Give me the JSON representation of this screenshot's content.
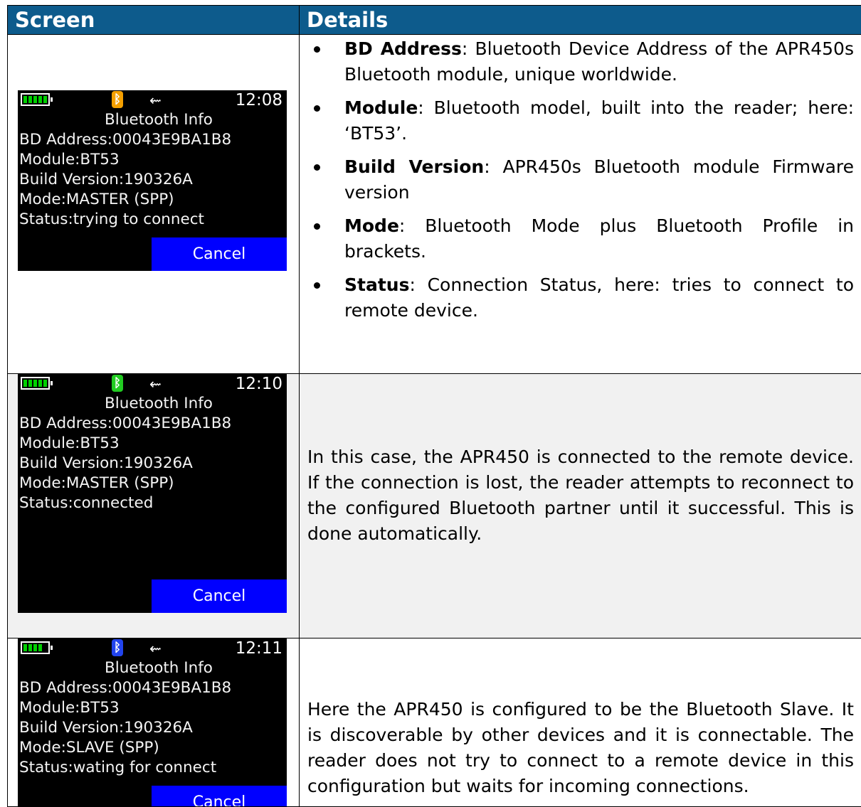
{
  "table": {
    "header_screen": "Screen",
    "header_details": "Details"
  },
  "colors": {
    "header_bg": "#0d5b8c",
    "cancel_bg": "#0000ff",
    "battery": "#00d000"
  },
  "rows": [
    {
      "screen": {
        "time": "12:08",
        "bt_icon_color": "#f5a000",
        "battery_segments": 5,
        "title": "Bluetooth Info",
        "lines": [
          "BD Address:00043E9BA1B8",
          "Module:BT53",
          "Build Version:190326A",
          "Mode:MASTER (SPP)",
          "Status:trying to connect"
        ],
        "cancel": "Cancel",
        "bt_icon": "bluetooth-icon",
        "usb_icon": "usb-icon"
      },
      "items": [
        {
          "term": "BD Address",
          "text": ": Bluetooth Device Address of the APR450s Bluetooth module, unique worldwide."
        },
        {
          "term": "Module",
          "text": ": Bluetooth model, built into the reader; here: ‘BT53’."
        },
        {
          "term": "Build Version",
          "text": ": APR450s Bluetooth module Firmware version"
        },
        {
          "term": "Mode",
          "text": ": Bluetooth Mode plus Bluetooth Profile in brackets."
        },
        {
          "term": "Status",
          "text": ": Connection Status, here: tries to connect to remote device."
        }
      ]
    },
    {
      "screen": {
        "time": "12:10",
        "bt_icon_color": "#22cc22",
        "battery_segments": 5,
        "title": "Bluetooth Info",
        "lines": [
          "BD Address:00043E9BA1B8",
          "Module:BT53",
          "Build Version:190326A",
          "Mode:MASTER (SPP)",
          "Status:connected"
        ],
        "cancel": "Cancel",
        "bt_icon": "bluetooth-icon",
        "usb_icon": "usb-icon"
      },
      "text": "In this case, the APR450 is connected to the remote device. If the connection is lost, the reader attempts to reconnect to the configured Bluetooth partner until it successful. This is done automatically."
    },
    {
      "screen": {
        "time": "12:11",
        "bt_icon_color": "#2244ee",
        "battery_segments": 4,
        "title": "Bluetooth Info",
        "lines": [
          "BD Address:00043E9BA1B8",
          "Module:BT53",
          "Build Version:190326A",
          "Mode:SLAVE (SPP)",
          "Status:wating for connect"
        ],
        "cancel": "Cancel",
        "bt_icon": "bluetooth-icon",
        "usb_icon": "usb-icon"
      },
      "text": "Here the APR450 is configured to be the Bluetooth Slave. It is discoverable by other devices and it is connectable. The reader does not try to connect to a remote device in this configuration but waits for incoming connections."
    }
  ]
}
